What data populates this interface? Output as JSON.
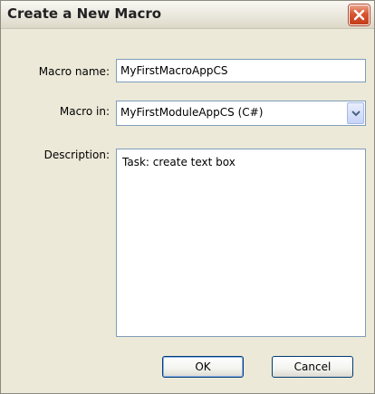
{
  "dialog": {
    "title": "Create a New Macro",
    "close_icon": "close-icon"
  },
  "form": {
    "macro_name_label": "Macro name:",
    "macro_name_value": "MyFirstMacroAppCS",
    "macro_in_label": "Macro in:",
    "macro_in_value": "MyFirstModuleAppCS (C#)",
    "description_label": "Description:",
    "description_value": "Task: create text box"
  },
  "buttons": {
    "ok_label": "OK",
    "cancel_label": "Cancel"
  },
  "colors": {
    "close_button": "#d9552f",
    "dialog_background": "#ece9d8",
    "input_border": "#7f9db9",
    "button_border": "#003c74"
  }
}
